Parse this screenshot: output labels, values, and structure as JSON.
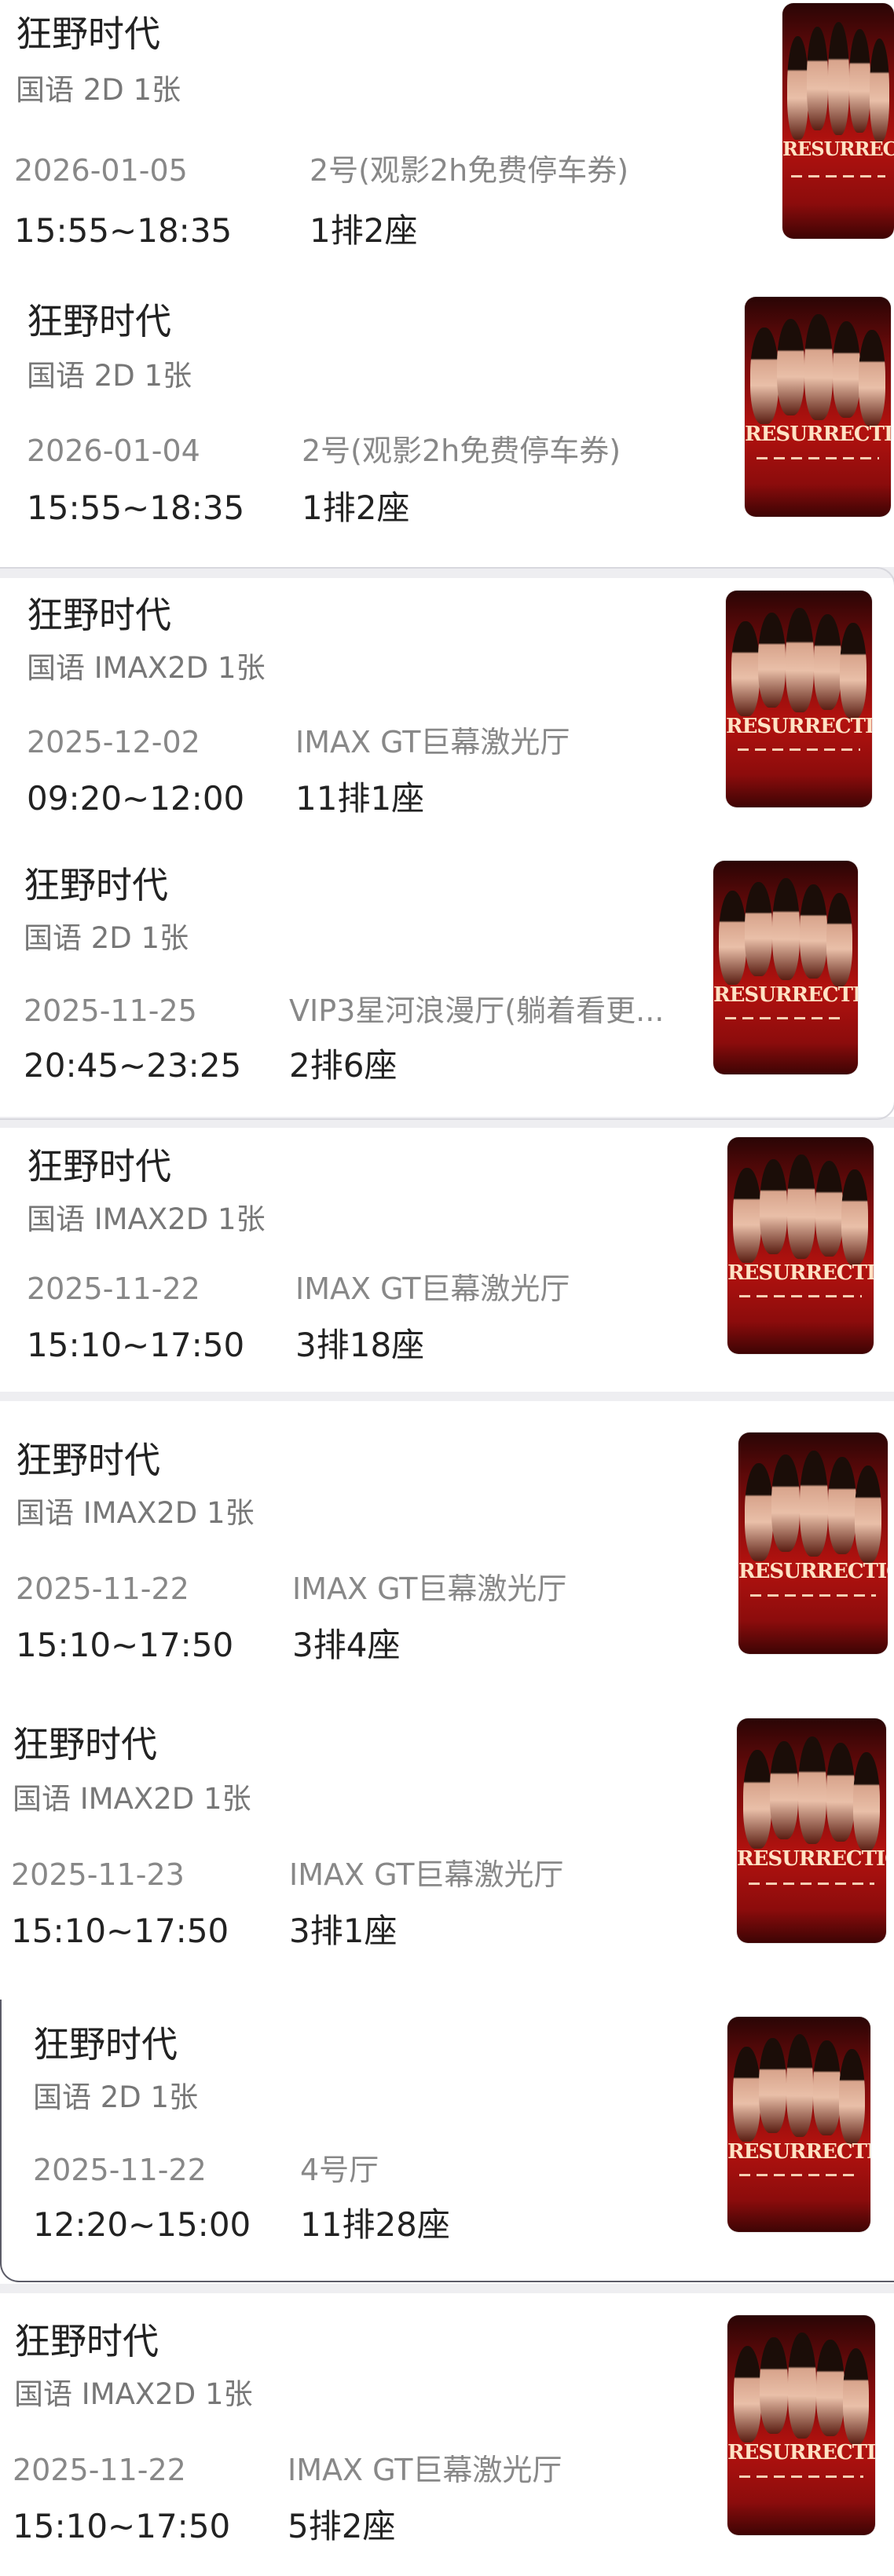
{
  "orders": [
    {
      "title": "狂野时代",
      "spec": "国语 2D 1张",
      "date": "2026-01-05",
      "hall": "2号(观影2h免费停车券)",
      "time": "15:55~18:35",
      "seat": "1排2座",
      "poster_text": "RESURRECTION"
    },
    {
      "title": "狂野时代",
      "spec": "国语 2D 1张",
      "date": "2026-01-04",
      "hall": "2号(观影2h免费停车券)",
      "time": "15:55~18:35",
      "seat": "1排2座",
      "poster_text": "RESURRECTION"
    },
    {
      "title": "狂野时代",
      "spec": "国语 IMAX2D 1张",
      "date": "2025-12-02",
      "hall": "IMAX GT巨幕激光厅",
      "time": "09:20~12:00",
      "seat": "11排1座",
      "poster_text": "RESURRECTION"
    },
    {
      "title": "狂野时代",
      "spec": "国语 2D 1张",
      "date": "2025-11-25",
      "hall": "VIP3星河浪漫厅(躺着看更...",
      "time": "20:45~23:25",
      "seat": "2排6座",
      "poster_text": "RESURRECTION"
    },
    {
      "title": "狂野时代",
      "spec": "国语 IMAX2D 1张",
      "date": "2025-11-22",
      "hall": "IMAX GT巨幕激光厅",
      "time": "15:10~17:50",
      "seat": "3排18座",
      "poster_text": "RESURRECTION"
    },
    {
      "title": "狂野时代",
      "spec": "国语 IMAX2D 1张",
      "date": "2025-11-22",
      "hall": "IMAX GT巨幕激光厅",
      "time": "15:10~17:50",
      "seat": "3排4座",
      "poster_text": "RESURRECTION"
    },
    {
      "title": "狂野时代",
      "spec": "国语 IMAX2D 1张",
      "date": "2025-11-23",
      "hall": "IMAX GT巨幕激光厅",
      "time": "15:10~17:50",
      "seat": "3排1座",
      "poster_text": "RESURRECTION"
    },
    {
      "title": "狂野时代",
      "spec": "国语 2D 1张",
      "date": "2025-11-22",
      "hall": "4号厅",
      "time": "12:20~15:00",
      "seat": "11排28座",
      "poster_text": "RESURRECTION"
    },
    {
      "title": "狂野时代",
      "spec": "国语 IMAX2D 1张",
      "date": "2025-11-22",
      "hall": "IMAX GT巨幕激光厅",
      "time": "15:10~17:50",
      "seat": "5排2座",
      "poster_text": "RESURRECTION"
    }
  ]
}
